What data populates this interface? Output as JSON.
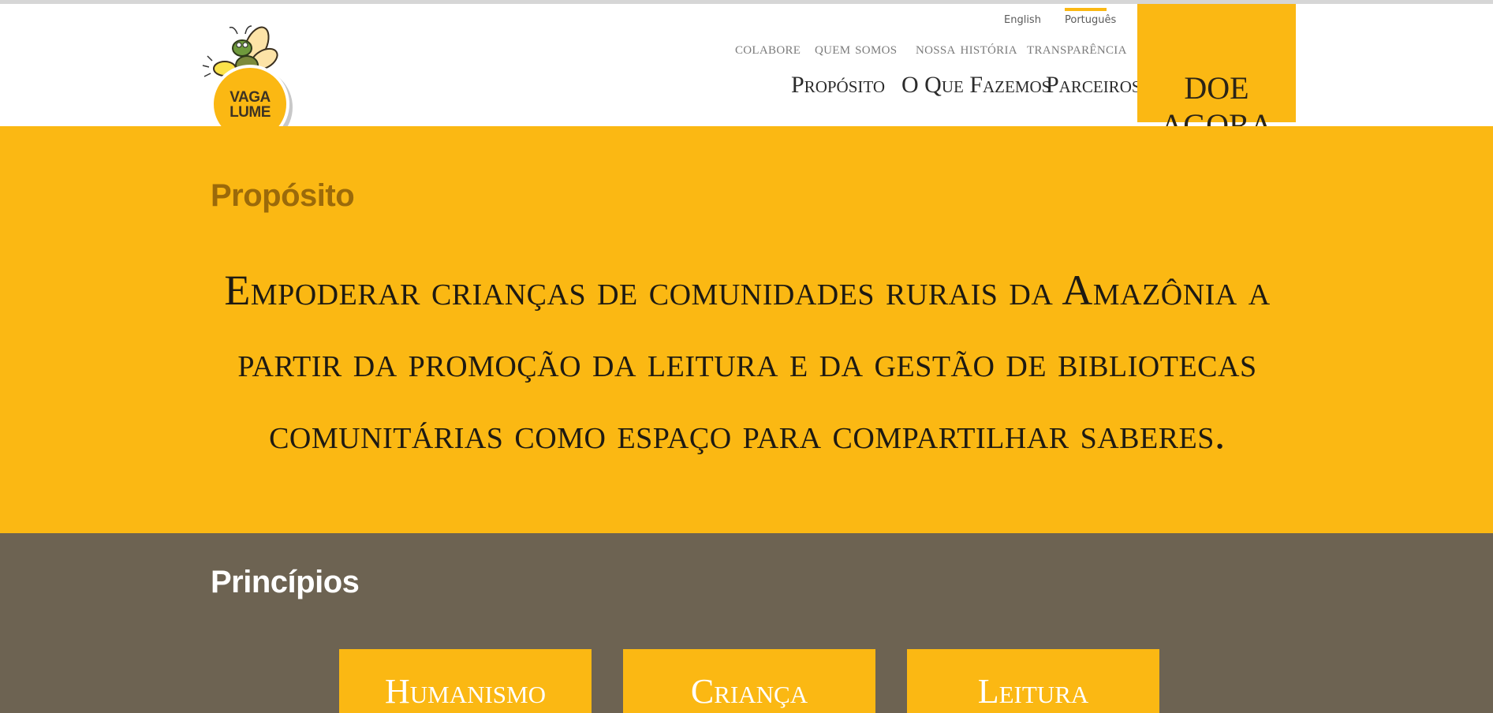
{
  "brand": {
    "logo_text_line1": "VAGA",
    "logo_text_line2": "LUME",
    "accent_color": "#fbb813",
    "dark_band_color": "#6d6352"
  },
  "language": {
    "english": "English",
    "portuguese": "Português",
    "selected": "Português"
  },
  "secondary_nav": [
    {
      "label": "colabore"
    },
    {
      "label": "quem somos"
    },
    {
      "label": "nossa história"
    },
    {
      "label": "transparência"
    }
  ],
  "main_nav": [
    {
      "label": "Propósito"
    },
    {
      "label": "O Que Fazemos"
    },
    {
      "label": "Parceiros"
    }
  ],
  "donate": {
    "label": "DOE AGORA"
  },
  "purpose": {
    "heading": "Propósito",
    "text": "Empoderar crianças de comunidades rurais da Amazônia a partir da promoção da leitura e da gestão de bibliotecas comunitárias como espaço para compartilhar saberes."
  },
  "principles": {
    "heading": "Princípios",
    "cards": [
      {
        "label": "Humanismo"
      },
      {
        "label": "Criança"
      },
      {
        "label": "Leitura"
      }
    ]
  }
}
